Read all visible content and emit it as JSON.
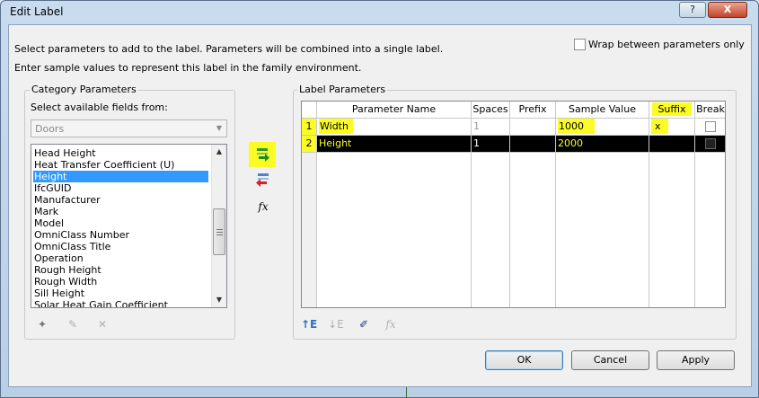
{
  "window": {
    "title": "Edit Label",
    "help_label": "?",
    "close_label": "X"
  },
  "instructions": {
    "line1": "Select parameters to add to the label.  Parameters will be combined into a single label.",
    "line2": "Enter sample values to represent this label in the family environment."
  },
  "wrap_option": {
    "label": "Wrap between parameters only",
    "checked": false
  },
  "category": {
    "group_label": "Category Parameters",
    "fields_label": "Select available fields from:",
    "category_value": "Doors",
    "items": [
      "Head Height",
      "Heat Transfer Coefficient (U)",
      "Height",
      "IfcGUID",
      "Manufacturer",
      "Mark",
      "Model",
      "OmniClass Number",
      "OmniClass Title",
      "Operation",
      "Rough Height",
      "Rough Width",
      "Sill Height",
      "Solar Heat Gain Coefficient"
    ],
    "selected_item": "Height"
  },
  "label_parameters": {
    "group_label": "Label Parameters",
    "headers": [
      "",
      "Parameter Name",
      "Spaces",
      "Prefix",
      "Sample Value",
      "Suffix",
      "Break"
    ],
    "rows": [
      {
        "num": "1",
        "name": "Width",
        "spaces": "1",
        "prefix": "",
        "sample": "1000",
        "suffix": "x",
        "break": false
      },
      {
        "num": "2",
        "name": "Height",
        "spaces": "1",
        "prefix": "",
        "sample": "2000",
        "suffix": "",
        "break": false
      }
    ]
  },
  "icons": {
    "add": "add-parameter-icon",
    "remove": "remove-parameter-icon",
    "formula": "fx",
    "formula_disabled": "fx"
  },
  "buttons": {
    "ok": "OK",
    "cancel": "Cancel",
    "apply": "Apply"
  },
  "colors": {
    "highlight": "#fcfc25",
    "selection": "#3399ff"
  }
}
